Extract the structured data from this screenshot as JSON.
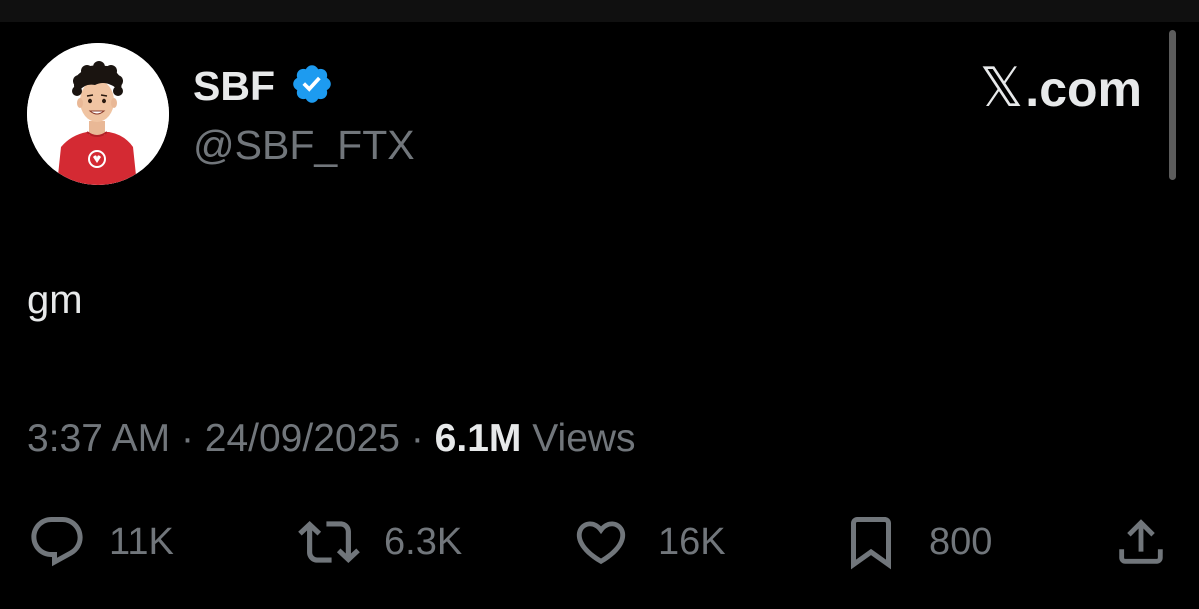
{
  "author": {
    "display_name": "SBF",
    "handle": "@SBF_FTX",
    "verified": true,
    "avatar_icon": "avatar-illustration-red-shirt"
  },
  "brand": {
    "x_mark": "𝕏",
    "label": ".com"
  },
  "tweet": {
    "text": "gm"
  },
  "meta": {
    "time": "3:37 AM",
    "separator": "·",
    "date": "24/09/2025",
    "views_count": "6.1M",
    "views_label": "Views"
  },
  "actions": {
    "reply": {
      "icon": "reply-icon",
      "count": "11K"
    },
    "retweet": {
      "icon": "retweet-icon",
      "count": "6.3K"
    },
    "like": {
      "icon": "heart-icon",
      "count": "16K"
    },
    "bookmark": {
      "icon": "bookmark-icon",
      "count": "800"
    },
    "share": {
      "icon": "share-icon"
    }
  },
  "colors": {
    "background": "#000000",
    "primary_text": "#e7e9ea",
    "secondary_text": "#71767b",
    "verified_blue": "#1d9bf0",
    "shirt_red": "#d42a33"
  }
}
